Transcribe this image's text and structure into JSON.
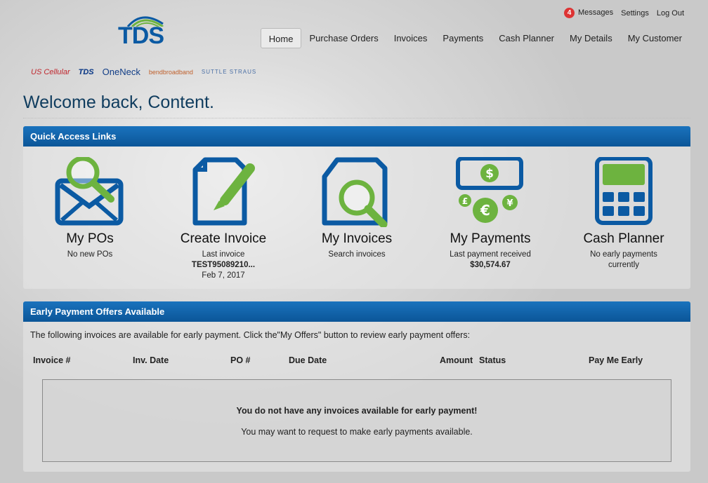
{
  "header": {
    "messages_count": "4",
    "messages_label": "Messages",
    "settings_label": "Settings",
    "logout_label": "Log Out",
    "logo_text": "TDS"
  },
  "nav": [
    "Home",
    "Purchase Orders",
    "Invoices",
    "Payments",
    "Cash Planner",
    "My Details",
    "My Customer"
  ],
  "brands": [
    "US Cellular",
    "TDS",
    "OneNeck",
    "bendbroadband",
    "SUTTLE STRAUS"
  ],
  "welcome": "Welcome back, Content.",
  "quick_access": {
    "title": "Quick Access Links",
    "tiles": [
      {
        "title": "My POs",
        "line1": "No new POs",
        "line2": "",
        "line3": ""
      },
      {
        "title": "Create Invoice",
        "line1": "Last invoice",
        "line2": "TEST95089210...",
        "line3": "Feb 7, 2017"
      },
      {
        "title": "My Invoices",
        "line1": "Search invoices",
        "line2": "",
        "line3": ""
      },
      {
        "title": "My Payments",
        "line1": "Last payment received",
        "line2": "$30,574.67",
        "line3": ""
      },
      {
        "title": "Cash Planner",
        "line1": "No early payments currently",
        "line2": "",
        "line3": ""
      }
    ]
  },
  "early_payment": {
    "title": "Early Payment Offers Available",
    "description": "The following invoices are available for early payment. Click the\"My Offers\" button to review early payment offers:",
    "columns": [
      "Invoice #",
      "Inv. Date",
      "PO #",
      "Due Date",
      "Amount",
      "Status",
      "Pay Me Early"
    ],
    "empty_title": "You do not have any invoices available for early payment!",
    "empty_sub": "You may want to request to make early payments available."
  },
  "colors": {
    "blue": "#0b5aa3",
    "green": "#6db33f",
    "accent": "#1a73bd"
  }
}
